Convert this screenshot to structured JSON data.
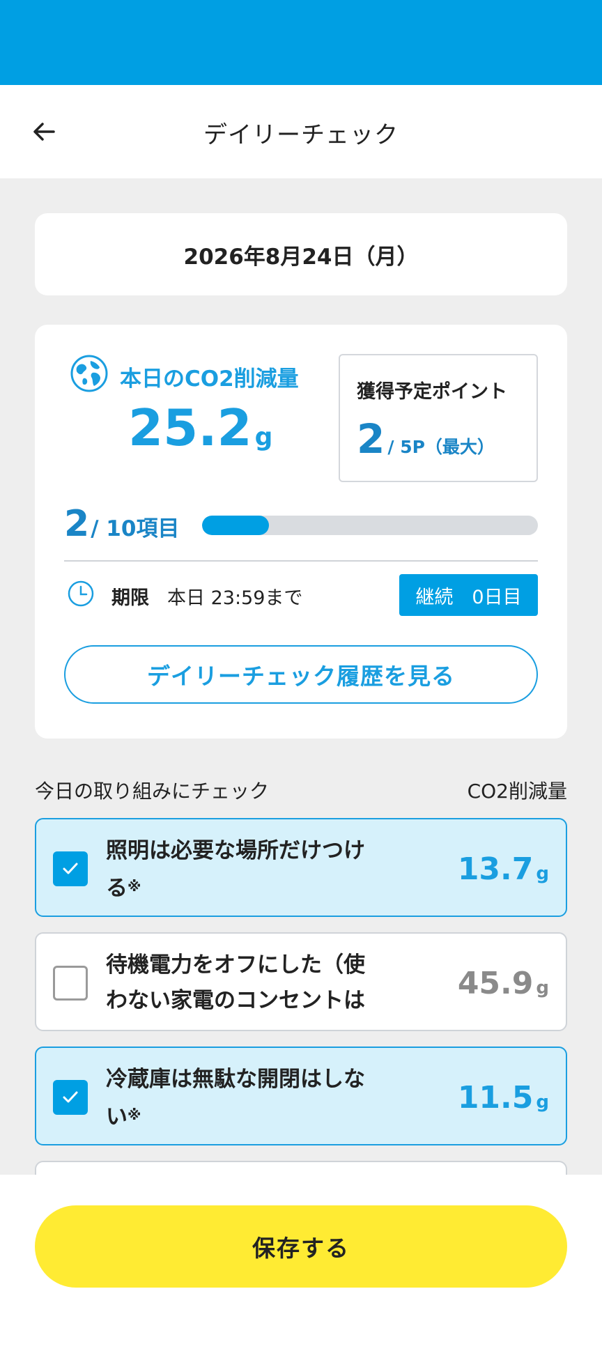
{
  "header": {
    "title": "デイリーチェック",
    "back_icon": "arrow-left-icon"
  },
  "date_label": "2026年8月24日（月）",
  "summary": {
    "co2_label": "本日のCO2削減量",
    "co2_value": "25.2",
    "co2_unit": "g",
    "points_label": "獲得予定ポイント",
    "points_current": "2",
    "points_suffix": "/ 5P（最大）",
    "progress_done": "2",
    "progress_suffix": "/ 10項目",
    "progress_fraction": 0.2,
    "deadline_label": "期限",
    "deadline_value": "本日 23:59まで",
    "streak_badge": "継続　0日目",
    "history_button": "デイリーチェック履歴を見る"
  },
  "list_header": {
    "left": "今日の取り組みにチェック",
    "right": "CO2削減量"
  },
  "items": [
    {
      "text": "照明は必要な場所だけつける",
      "note": "※",
      "note_num": "1",
      "value": "13.7",
      "unit": "g",
      "checked": true
    },
    {
      "text": "待機電力をオフにした（使わない家電のコンセントは抜いた…",
      "note": "",
      "note_num": "",
      "value": "45.9",
      "unit": "g",
      "checked": false
    },
    {
      "text": "冷蔵庫は無駄な開閉はしない",
      "note": "※",
      "note_num": "1",
      "value": "11.5",
      "unit": "g",
      "checked": true
    }
  ],
  "footer": {
    "save_button": "保存する"
  },
  "colors": {
    "brand_blue": "#009fe3",
    "checked_bg": "#d6f1fb",
    "save_yellow": "#ffeb33"
  }
}
